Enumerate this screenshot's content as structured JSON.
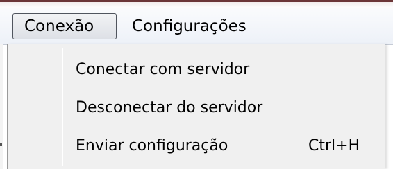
{
  "menubar": {
    "items": [
      {
        "label": "Conexão",
        "open": true
      },
      {
        "label": "Configurações",
        "open": false
      }
    ]
  },
  "dropdown": {
    "items": [
      {
        "label": "Conectar com servidor",
        "shortcut": ""
      },
      {
        "label": "Desconectar do servidor",
        "shortcut": ""
      },
      {
        "label": "Enviar configuração",
        "shortcut": "Ctrl+H"
      }
    ]
  },
  "colors": {
    "menubar_bg": "#edf1f8",
    "dropdown_bg": "#f0f0f0",
    "open_item_border": "#50555e",
    "title_bar_accent": "#6c3638"
  }
}
